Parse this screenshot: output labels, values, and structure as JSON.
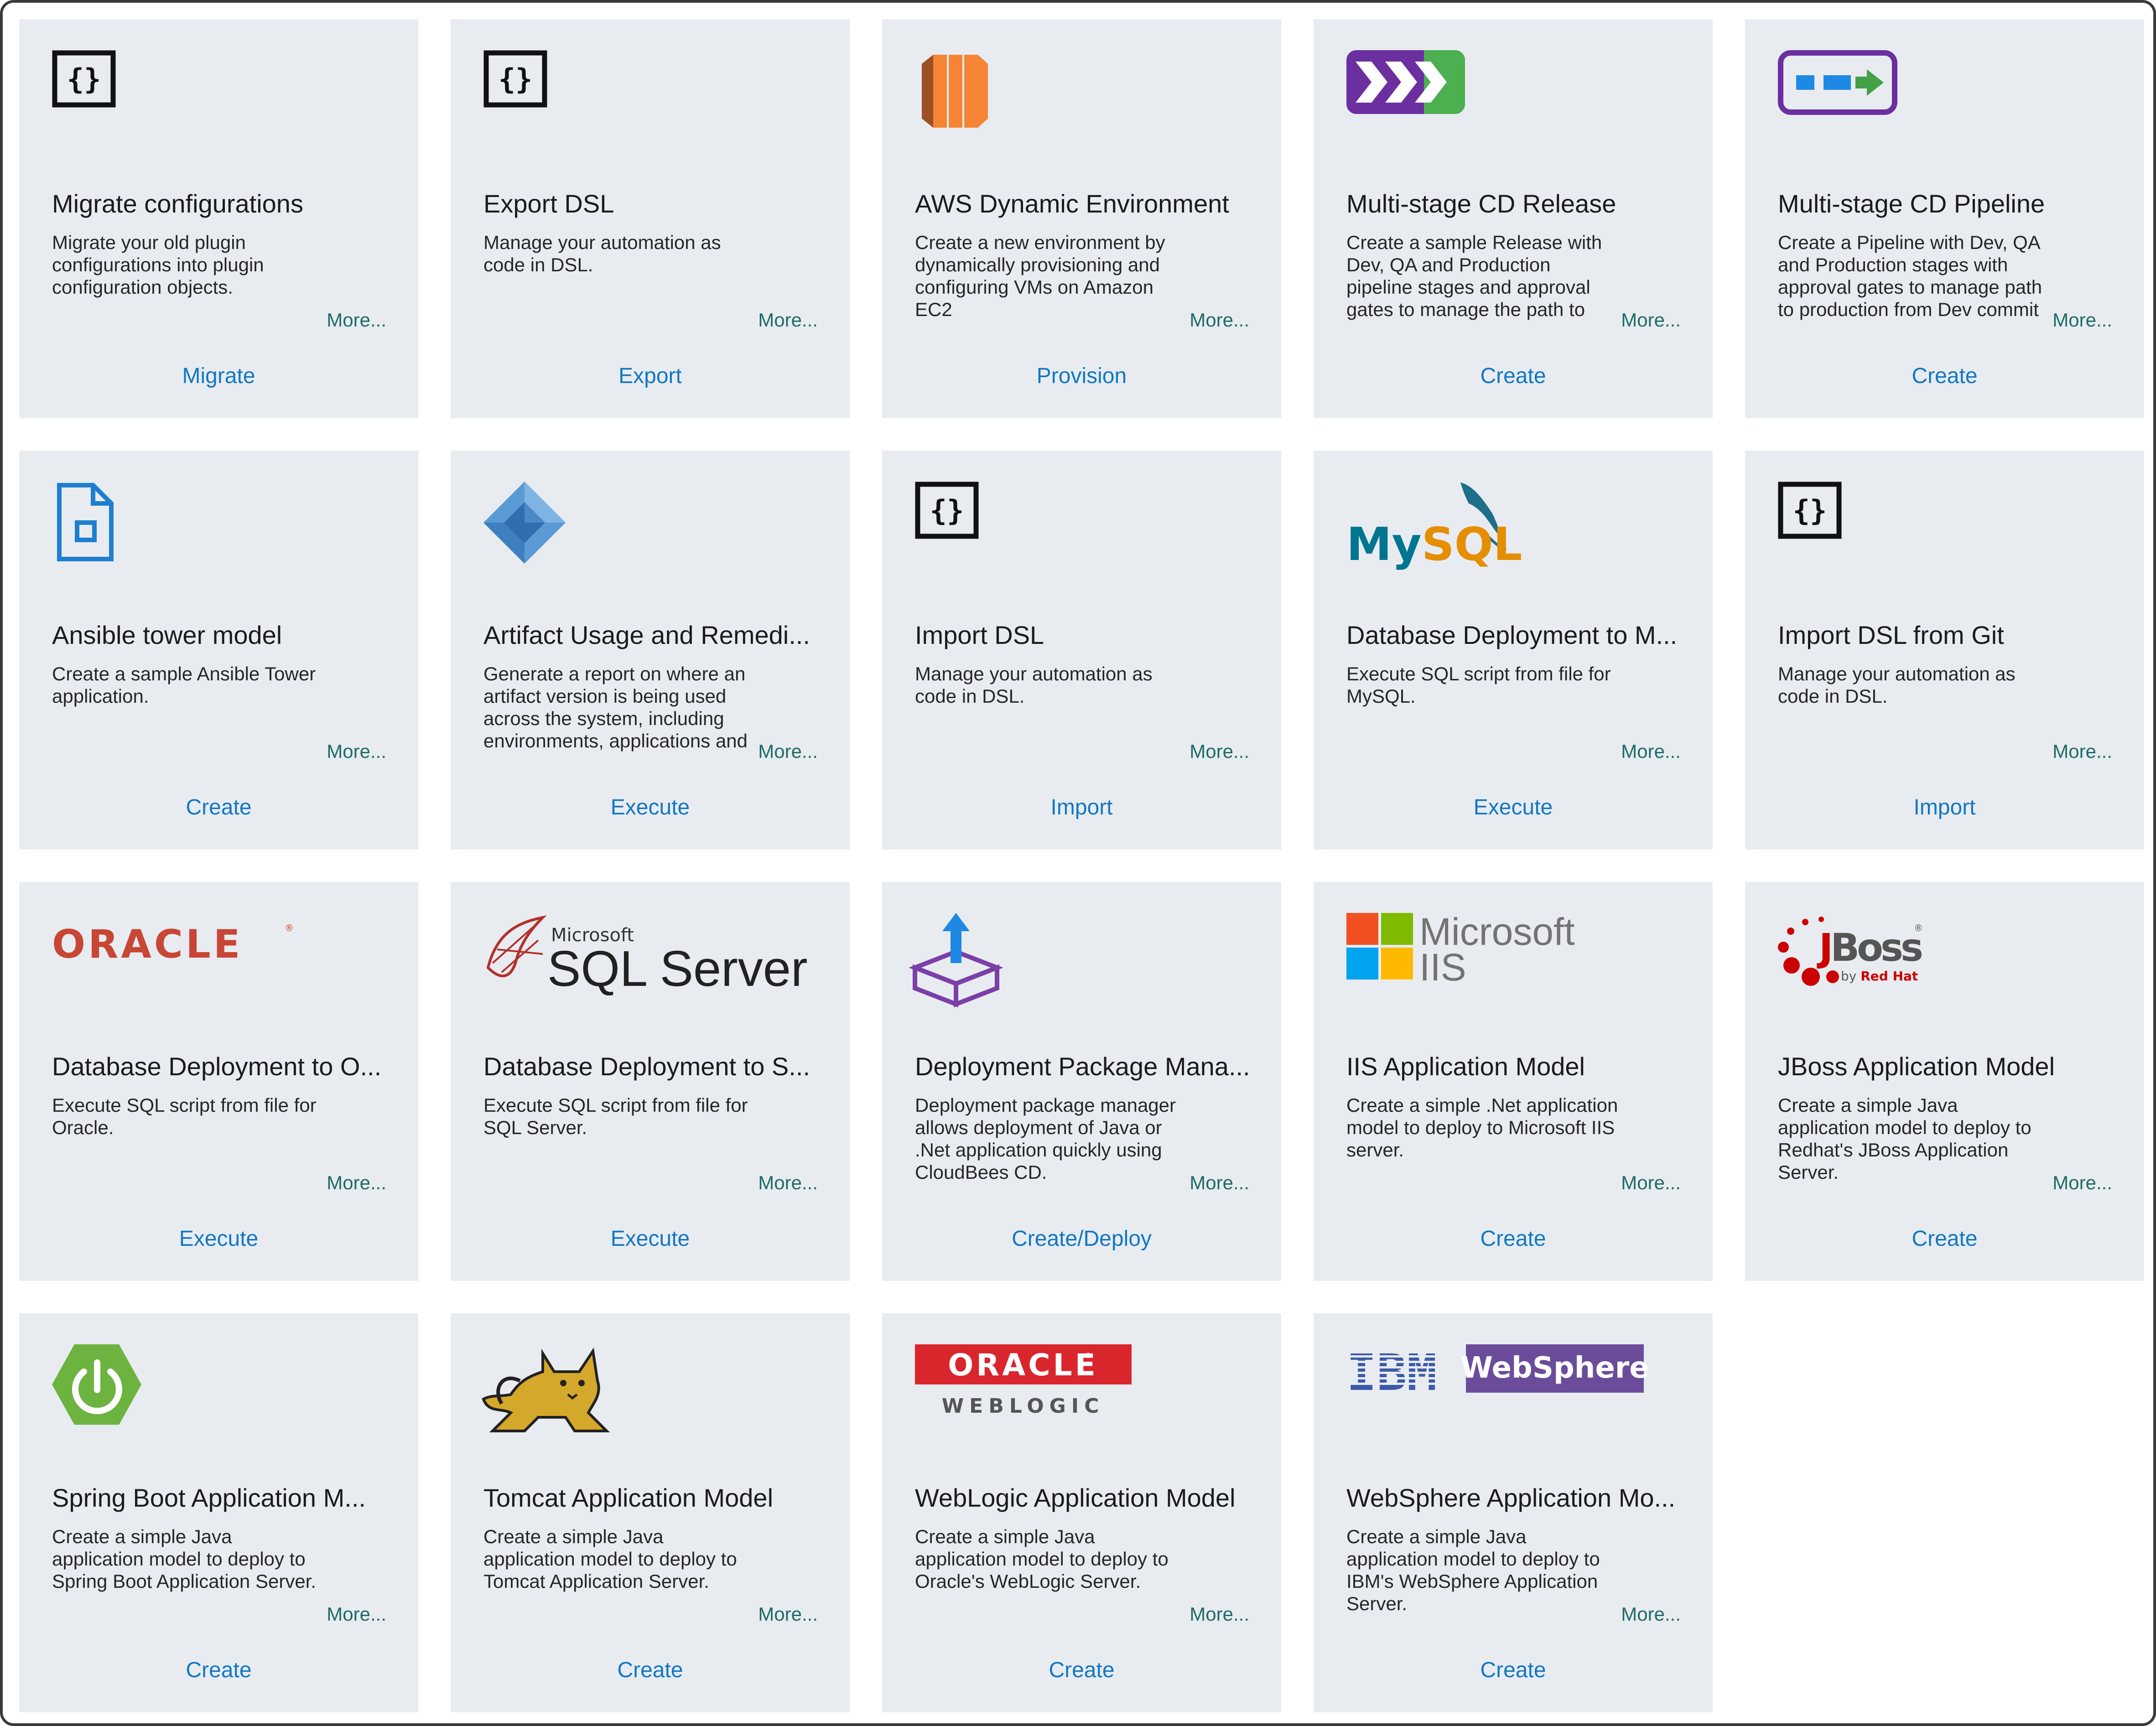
{
  "more_label": "More...",
  "cards": [
    {
      "title": "Migrate configurations",
      "description": "Migrate your old plugin configurations into plugin configuration objects.",
      "action": "Migrate",
      "icon": "code-braces-icon"
    },
    {
      "title": "Export DSL",
      "description": "Manage your automation as code in DSL.",
      "action": "Export",
      "icon": "code-braces-icon"
    },
    {
      "title": "AWS Dynamic Environment",
      "description": "Create a new environment by dynamically provisioning and configuring VMs on Amazon EC2",
      "action": "Provision",
      "icon": "aws-ec2-icon"
    },
    {
      "title": "Multi-stage CD Release",
      "description": "Create a sample Release with Dev, QA and Production pipeline stages and approval gates to manage the path to production from Dev commit",
      "action": "Create",
      "icon": "release-icon"
    },
    {
      "title": "Multi-stage CD Pipeline",
      "description": "Create a Pipeline with Dev, QA and Production stages with approval gates to manage path to production from Dev commit to Production",
      "action": "Create",
      "icon": "pipeline-icon"
    },
    {
      "title": "Ansible tower model",
      "description": "Create a sample Ansible Tower application.",
      "action": "Create",
      "icon": "document-icon"
    },
    {
      "title": "Artifact Usage and Remedi...",
      "description": "Generate a report on where an artifact version is being used across the system, including environments, applications and master",
      "action": "Execute",
      "icon": "artifact-diamond-icon"
    },
    {
      "title": "Import DSL",
      "description": "Manage your automation as code in DSL.",
      "action": "Import",
      "icon": "code-braces-icon"
    },
    {
      "title": "Database Deployment to M...",
      "description": "Execute SQL script from file for MySQL.",
      "action": "Execute",
      "icon": "mysql-logo-icon",
      "logo_text": "MySQL"
    },
    {
      "title": "Import DSL from Git",
      "description": "Manage your automation as code in DSL.",
      "action": "Import",
      "icon": "code-braces-icon"
    },
    {
      "title": "Database Deployment to O...",
      "description": "Execute SQL script from file for Oracle.",
      "action": "Execute",
      "icon": "oracle-logo-icon",
      "logo_text": "ORACLE"
    },
    {
      "title": "Database Deployment to S...",
      "description": "Execute SQL script from file for SQL Server.",
      "action": "Execute",
      "icon": "sql-server-logo-icon",
      "logo_text": "SQL Server",
      "logo_subtext": "Microsoft"
    },
    {
      "title": "Deployment Package Mana...",
      "description": "Deployment package manager allows deployment of Java or .Net application quickly using CloudBees CD.",
      "action": "Create/Deploy",
      "icon": "package-box-icon"
    },
    {
      "title": "IIS Application Model",
      "description": "Create a simple .Net application model to deploy to Microsoft IIS server.",
      "action": "Create",
      "icon": "microsoft-iis-logo-icon",
      "logo_text": "Microsoft",
      "logo_subtext": "IIS"
    },
    {
      "title": "JBoss Application Model",
      "description": "Create a simple Java application model to deploy to Redhat's JBoss Application Server.",
      "action": "Create",
      "icon": "jboss-logo-icon",
      "logo_text": "JBoss",
      "logo_subtext": "by Red Hat"
    },
    {
      "title": "Spring Boot Application M...",
      "description": "Create a simple Java application model to deploy to Spring Boot Application Server.",
      "action": "Create",
      "icon": "spring-boot-power-icon"
    },
    {
      "title": "Tomcat Application Model",
      "description": "Create a simple Java application model to deploy to Tomcat Application Server.",
      "action": "Create",
      "icon": "tomcat-cat-icon"
    },
    {
      "title": "WebLogic Application Model",
      "description": "Create a simple Java application model to deploy to Oracle's WebLogic Server.",
      "action": "Create",
      "icon": "oracle-weblogic-logo-icon",
      "logo_text": "ORACLE",
      "logo_subtext": "WEBLOGIC"
    },
    {
      "title": "WebSphere Application Mo...",
      "description": "Create a simple Java application model to deploy to IBM's WebSphere Application Server.",
      "action": "Create",
      "icon": "ibm-websphere-logo-icon",
      "logo_text": "IBM",
      "logo_subtext": "WebSphere"
    }
  ],
  "colors": {
    "card_background": "#e8ecf1",
    "action_link": "#1277c2",
    "more_link": "#1f6b66",
    "oracle_red": "#c74634",
    "websphere_purple": "#6b4c9a",
    "ibm_blue": "#3c5aa8",
    "spring_green": "#6db33f",
    "aws_orange": "#f58534"
  }
}
